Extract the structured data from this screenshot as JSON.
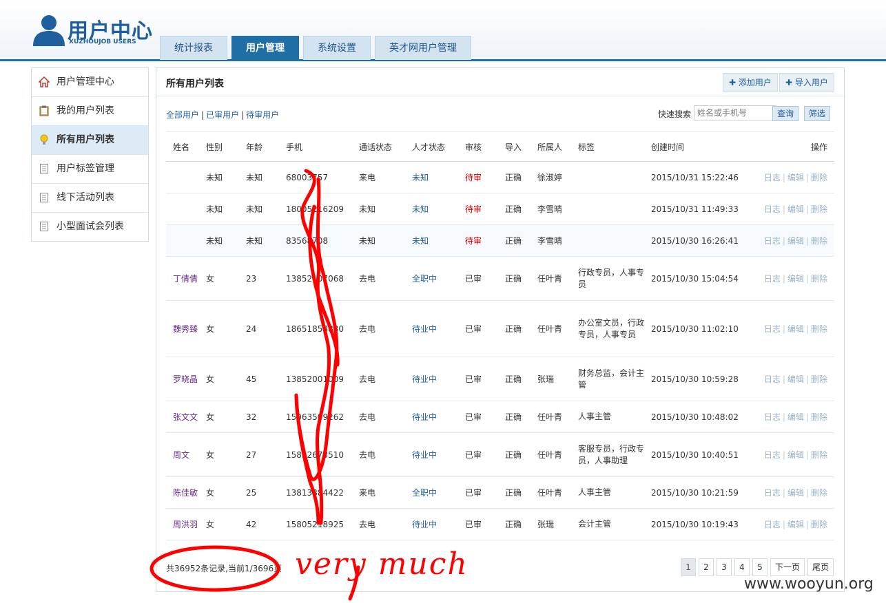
{
  "header": {
    "logo_title": "用户中心",
    "logo_subtitle": "XUZHOUJOB USERS",
    "tabs": [
      "统计报表",
      "用户管理",
      "系统设置",
      "英才网用户管理"
    ],
    "active_tab": 1
  },
  "sidebar": {
    "items": [
      {
        "label": "用户管理中心",
        "icon": "home-icon"
      },
      {
        "label": "我的用户列表",
        "icon": "clipboard-icon"
      },
      {
        "label": "所有用户列表",
        "icon": "lightbulb-icon"
      },
      {
        "label": "用户标签管理",
        "icon": "document-icon"
      },
      {
        "label": "线下活动列表",
        "icon": "document-icon"
      },
      {
        "label": "小型面试会列表",
        "icon": "document-icon"
      }
    ],
    "active_index": 2
  },
  "main": {
    "title": "所有用户列表",
    "add_user": "添加用户",
    "import_user": "导入用户",
    "filters": [
      "全部用户",
      "已审用户",
      "待审用户"
    ],
    "search_label": "快速搜索",
    "search_placeholder": "姓名或手机号",
    "query_button": "查询",
    "filter_button": "筛选",
    "columns": [
      "姓名",
      "性别",
      "年龄",
      "手机",
      "通话状态",
      "人才状态",
      "审核",
      "导入",
      "所属人",
      "标签",
      "创建时间",
      "操作"
    ],
    "ops": {
      "log": "日志",
      "edit": "编辑",
      "delete": "删除"
    },
    "rows": [
      {
        "name": "",
        "gender": "未知",
        "age": "未知",
        "phone": "68003757",
        "call": "来电",
        "talent": "未知",
        "audit": "待审",
        "import": "正确",
        "owner": "徐淑婷",
        "tags": "",
        "created": "2015/10/31 15:22:46"
      },
      {
        "name": "",
        "gender": "未知",
        "age": "未知",
        "phone": "18005216209",
        "call": "未知",
        "talent": "未知",
        "audit": "待审",
        "import": "正确",
        "owner": "李雪晴",
        "tags": "",
        "created": "2015/10/31 11:49:33"
      },
      {
        "name": "",
        "gender": "未知",
        "age": "未知",
        "phone": "83568708",
        "call": "未知",
        "talent": "未知",
        "audit": "待审",
        "import": "正确",
        "owner": "李雪晴",
        "tags": "",
        "created": "2015/10/30 16:26:41"
      },
      {
        "name": "丁倩倩",
        "gender": "女",
        "age": "23",
        "phone": "13852107068",
        "call": "去电",
        "talent": "全职中",
        "audit": "已审",
        "import": "正确",
        "owner": "任叶青",
        "tags": "行政专员，人事专员",
        "created": "2015/10/30 15:04:54"
      },
      {
        "name": "魏秀臻",
        "gender": "女",
        "age": "24",
        "phone": "18651858830",
        "call": "去电",
        "talent": "待业中",
        "audit": "已审",
        "import": "正确",
        "owner": "任叶青",
        "tags": "办公室文员，行政专员，人事专员",
        "created": "2015/10/30 11:02:10"
      },
      {
        "name": "罗晓晶",
        "gender": "女",
        "age": "45",
        "phone": "13852001009",
        "call": "去电",
        "talent": "待业中",
        "audit": "已审",
        "import": "正确",
        "owner": "张瑞",
        "tags": "财务总监，会计主管",
        "created": "2015/10/30 10:59:28"
      },
      {
        "name": "张文文",
        "gender": "女",
        "age": "32",
        "phone": "15063509262",
        "call": "去电",
        "talent": "待业中",
        "audit": "已审",
        "import": "正确",
        "owner": "任叶青",
        "tags": "人事主管",
        "created": "2015/10/30 10:48:02"
      },
      {
        "name": "周文",
        "gender": "女",
        "age": "27",
        "phone": "15852673510",
        "call": "去电",
        "talent": "待业中",
        "audit": "已审",
        "import": "正确",
        "owner": "任叶青",
        "tags": "客服专员，行政专员，人事助理",
        "created": "2015/10/30 10:40:51"
      },
      {
        "name": "陈佳敏",
        "gender": "女",
        "age": "25",
        "phone": "13813884422",
        "call": "来电",
        "talent": "全职中",
        "audit": "已审",
        "import": "正确",
        "owner": "任叶青",
        "tags": "人事主管",
        "created": "2015/10/30 10:21:59"
      },
      {
        "name": "周洪羽",
        "gender": "女",
        "age": "42",
        "phone": "15805218925",
        "call": "去电",
        "talent": "待业中",
        "audit": "已审",
        "import": "正确",
        "owner": "张瑞",
        "tags": "会计主管",
        "created": "2015/10/30 10:19:43"
      }
    ],
    "pager_info": "共36952条记录,当前1/3696页",
    "pages": [
      "1",
      "2",
      "3",
      "4",
      "5",
      "下一页",
      "尾页"
    ]
  },
  "annotation": {
    "handwriting": "very much",
    "watermark": "www.wooyun.org",
    "color": "#ff0000"
  }
}
